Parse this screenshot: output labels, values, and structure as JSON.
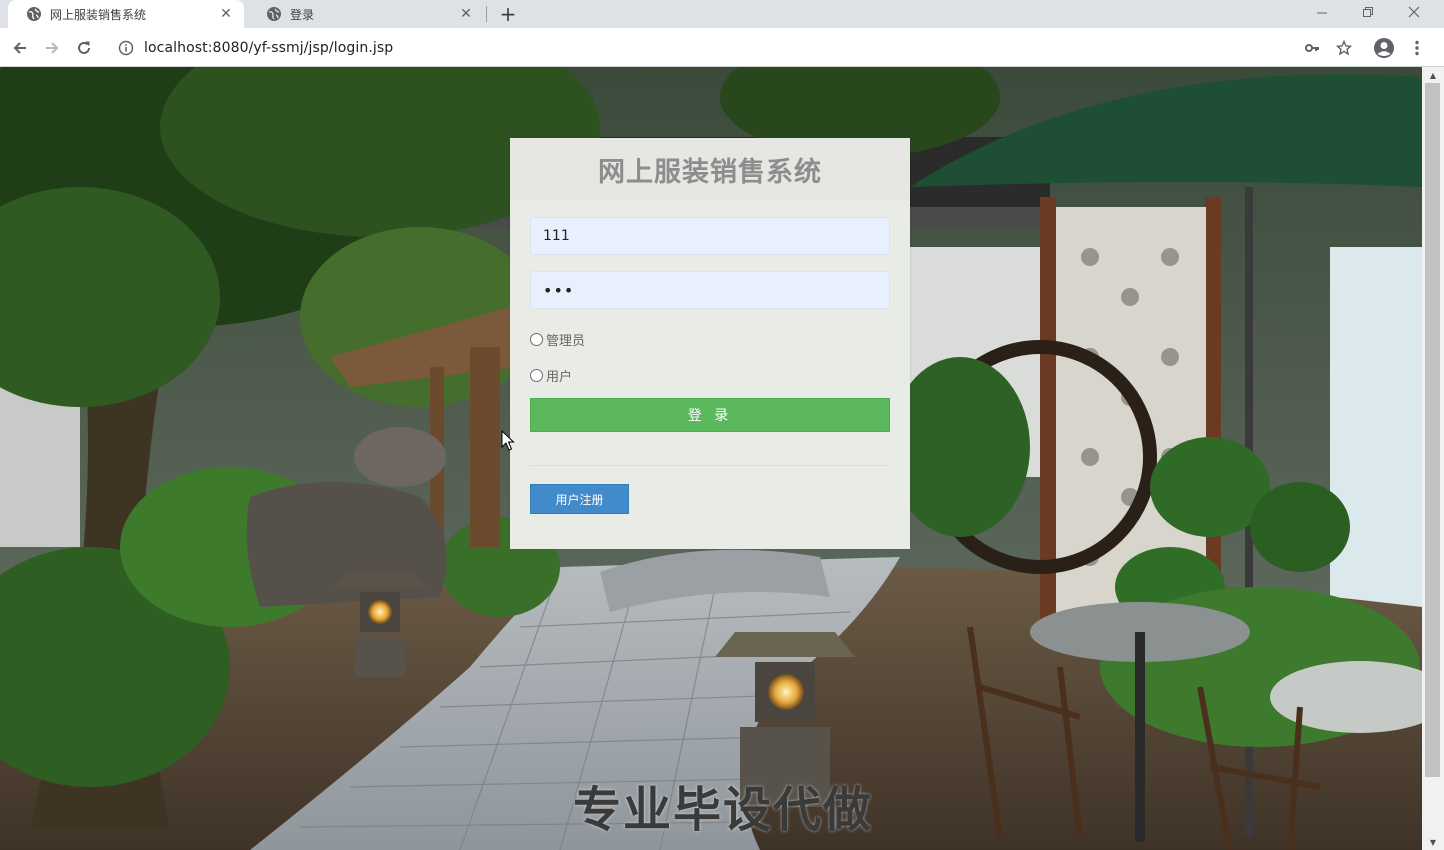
{
  "browser": {
    "tabs": [
      {
        "title": "网上服装销售系统",
        "active": true
      },
      {
        "title": "登录",
        "active": false
      }
    ],
    "url": "localhost:8080/yf-ssmj/jsp/login.jsp"
  },
  "login": {
    "title": "网上服装销售系统",
    "username_value": "111",
    "password_mask": "•••",
    "roles": [
      "管理员",
      "用户"
    ],
    "login_label": "登 录",
    "register_label": "用户注册"
  },
  "watermark": "专业毕设代做",
  "colors": {
    "login_button": "#5cb85c",
    "register_button": "#428bca",
    "input_bg": "#e8f0fe"
  }
}
